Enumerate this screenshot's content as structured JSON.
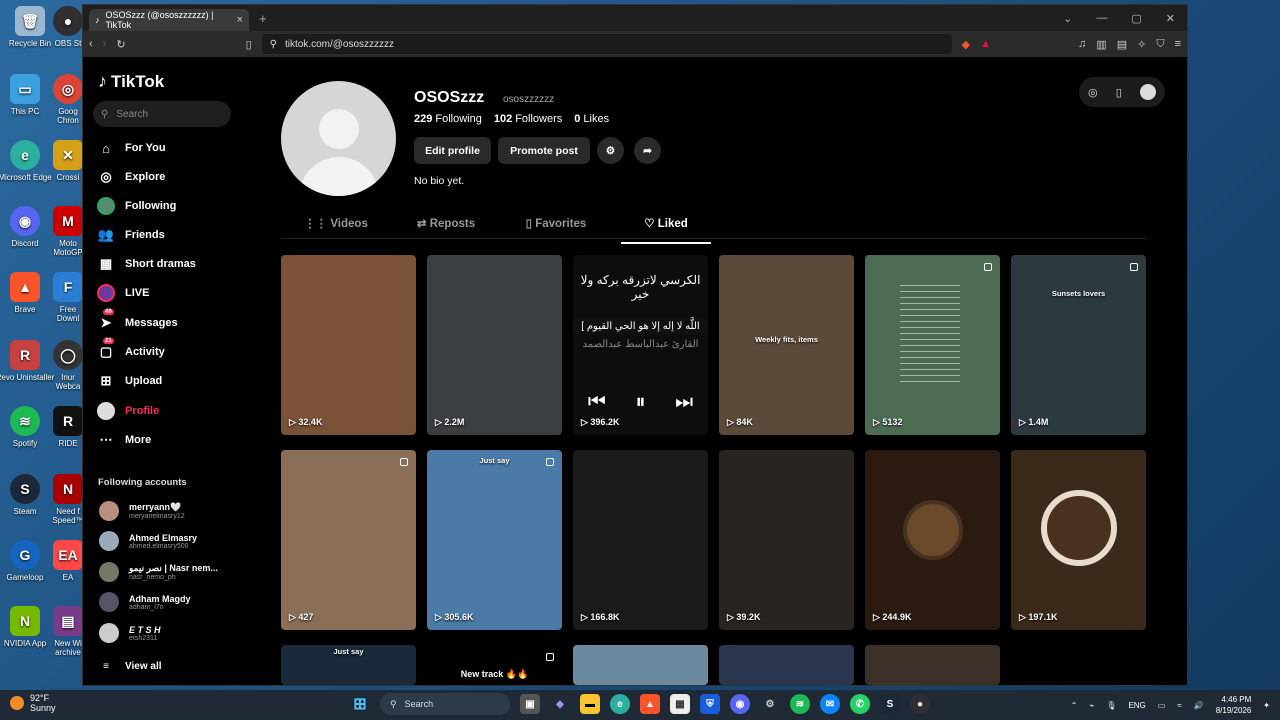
{
  "desktop": {
    "icons_left": [
      "Recycle Bin",
      "This PC",
      "Microsoft Edge",
      "Discord",
      "Brave",
      "Revo Uninstaller",
      "Spotify",
      "Steam",
      "Gameloop",
      "NVIDIA App"
    ],
    "icons_right": [
      "OBS St",
      "Goog Chron",
      "Crossi",
      "Moto MotoGP",
      "Free Downl",
      "Inur Webca",
      "RIDE",
      "Need f Speed™",
      "EA",
      "New Wi archive"
    ]
  },
  "browser": {
    "tab_title": "OSOSzzz (@ososzzzzzz) | TikTok",
    "url": "tiktok.com/@ososzzzzzz",
    "brave_badge": "▲"
  },
  "sidebar": {
    "logo": "TikTok",
    "search_placeholder": "Search",
    "nav": [
      {
        "label": "For You",
        "icon": "home-icon"
      },
      {
        "label": "Explore",
        "icon": "compass-icon"
      },
      {
        "label": "Following",
        "icon": "following-avatar-icon"
      },
      {
        "label": "Friends",
        "icon": "friends-icon"
      },
      {
        "label": "Short dramas",
        "icon": "film-icon"
      },
      {
        "label": "LIVE",
        "icon": "live-icon"
      },
      {
        "label": "Messages",
        "icon": "messages-icon",
        "badge": "49"
      },
      {
        "label": "Activity",
        "icon": "activity-icon",
        "badge": "21"
      },
      {
        "label": "Upload",
        "icon": "upload-icon"
      },
      {
        "label": "Profile",
        "icon": "profile-icon"
      },
      {
        "label": "More",
        "icon": "more-icon"
      }
    ],
    "following_title": "Following accounts",
    "accounts": [
      {
        "name": "merryann🤍",
        "handle": "meryanelmasry12"
      },
      {
        "name": "Ahmed Elmasry",
        "handle": "ahmed.elmasry500"
      },
      {
        "name": "نصر نيمو | Nasr nem...",
        "handle": "nasr_nemo_ph"
      },
      {
        "name": "Adham Magdy",
        "handle": "adham_l7n"
      },
      {
        "name": "E T S H",
        "handle": "etsh2311"
      }
    ],
    "view_all": "View all"
  },
  "profile": {
    "name": "OSOSzzz",
    "handle": "ososzzzzzz",
    "following_count": "229",
    "following_label": "Following",
    "followers_count": "102",
    "followers_label": "Followers",
    "likes_count": "0",
    "likes_label": "Likes",
    "edit_label": "Edit profile",
    "promote_label": "Promote post",
    "bio": "No bio yet."
  },
  "tabs": [
    "Videos",
    "Reposts",
    "Favorites",
    "Liked"
  ],
  "active_tab": "Liked",
  "videos": [
    {
      "views": "32.4K",
      "bg": "#7a5238"
    },
    {
      "views": "2.2M",
      "bg": "#3c3f42"
    },
    {
      "views": "396.2K",
      "bg": "#0d0d0d",
      "arabic1": "الكرسي لاتزرقه بركه ولا خير",
      "arabic2": "[ اللَّه لا إله إلا هو الحي القيوم",
      "arabic3": "القارئ عبدالباسط عبدالصمد"
    },
    {
      "views": "84K",
      "bg": "#5b4a3a",
      "caption": "Weekly fits, items"
    },
    {
      "views": "5132",
      "bg": "#4d6b52"
    },
    {
      "views": "1.4M",
      "bg": "#2c3a3e",
      "caption": "Sunsets lovers"
    },
    {
      "views": "427",
      "bg": "#8a6e58"
    },
    {
      "views": "305.6K",
      "bg": "#4a7aa8",
      "caption": "Just say"
    },
    {
      "views": "166.8K",
      "bg": "#1a1a1a"
    },
    {
      "views": "39.2K",
      "bg": "#2a2420"
    },
    {
      "views": "244.9K",
      "bg": "#2a1a10"
    },
    {
      "views": "197.1K",
      "bg": "#3a2a1a"
    },
    {
      "views": "",
      "bg": "#1a2a3a",
      "caption": "Just say"
    },
    {
      "views": "",
      "bg": "#000",
      "caption": "New track 🔥🔥"
    },
    {
      "views": "",
      "bg": "#6b8aa0"
    },
    {
      "views": "",
      "bg": "#2a3550"
    },
    {
      "views": "",
      "bg": "#3a3028"
    }
  ],
  "taskbar": {
    "temp": "92°F",
    "weather": "Sunny",
    "search": "Search",
    "lang": "ENG",
    "time": "4:46 PM",
    "date": "8/19/2026"
  }
}
